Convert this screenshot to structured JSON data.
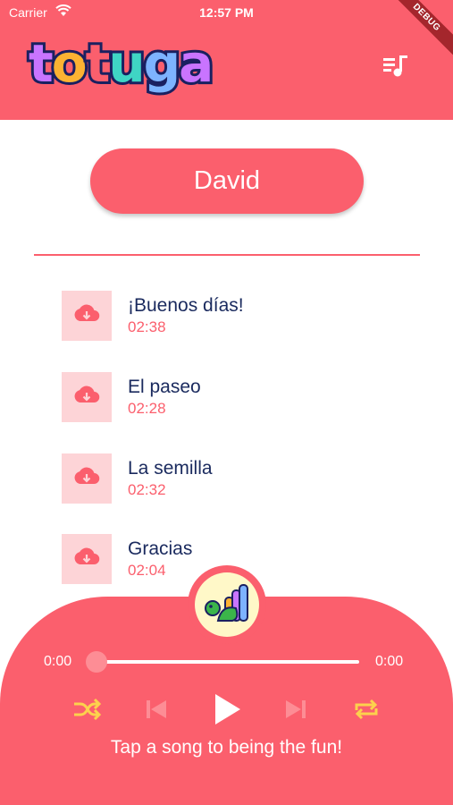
{
  "status_bar": {
    "carrier": "Carrier",
    "time": "12:57 PM",
    "debug_badge": "DEBUG"
  },
  "header": {
    "logo_text": "totuga",
    "logo_letters": [
      "t",
      "o",
      "t",
      "u",
      "g",
      "a"
    ],
    "playlist_icon": "playlist-music-icon"
  },
  "profile": {
    "name": "David"
  },
  "songs": [
    {
      "title": "¡Buenos días!",
      "duration": "02:38",
      "icon": "cloud-download-icon"
    },
    {
      "title": "El paseo",
      "duration": "02:28",
      "icon": "cloud-download-icon"
    },
    {
      "title": "La semilla",
      "duration": "02:32",
      "icon": "cloud-download-icon"
    },
    {
      "title": "Gracias",
      "duration": "02:04",
      "icon": "cloud-download-icon"
    }
  ],
  "player": {
    "elapsed": "0:00",
    "total": "0:00",
    "progress": 0,
    "hint": "Tap a song to being the fun!",
    "controls": [
      "shuffle-icon",
      "skip-previous-icon",
      "play-icon",
      "skip-next-icon",
      "repeat-icon"
    ]
  },
  "colors": {
    "brand": "#fb5f6d",
    "thumb_bg": "#fdd4d7",
    "title_text": "#1a2a5e",
    "accent_yellow": "#fcd14d",
    "disabled": "#fd8d95"
  }
}
